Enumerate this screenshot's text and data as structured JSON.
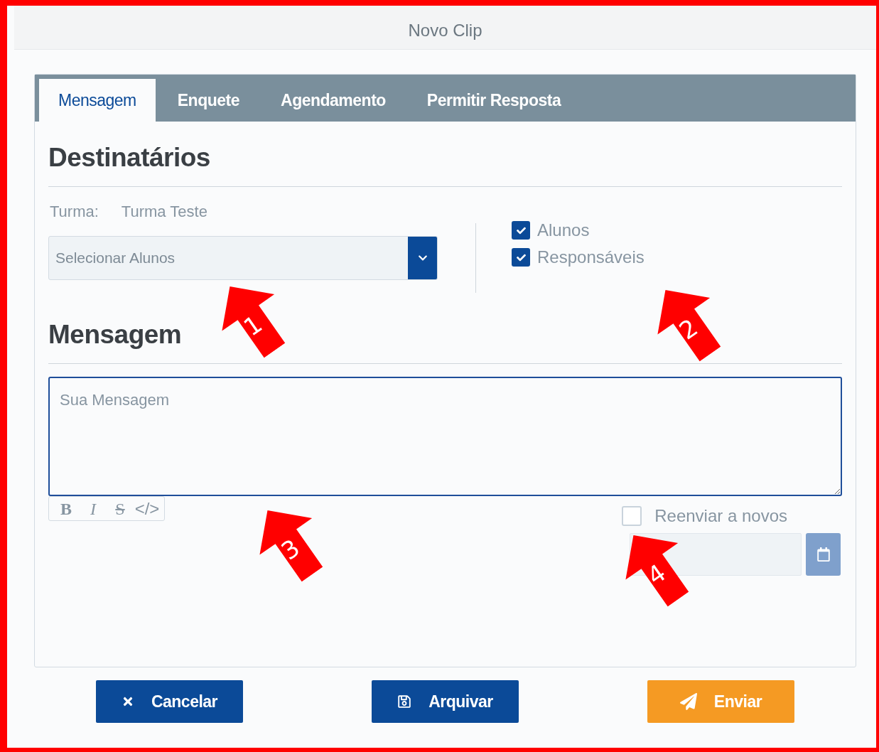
{
  "dialog": {
    "title": "Novo Clip"
  },
  "tabs": [
    {
      "label": "Mensagem",
      "selected": true
    },
    {
      "label": "Enquete",
      "selected": false
    },
    {
      "label": "Agendamento",
      "selected": false
    },
    {
      "label": "Permitir Resposta",
      "selected": false
    }
  ],
  "recipients": {
    "heading": "Destinatários",
    "class_label": "Turma:",
    "class_value": "Turma Teste",
    "select_placeholder": "Selecionar Alunos",
    "options": [
      {
        "label": "Alunos",
        "checked": true
      },
      {
        "label": "Responsáveis",
        "checked": true
      }
    ]
  },
  "message": {
    "heading": "Mensagem",
    "placeholder": "Sua Mensagem",
    "format_buttons": [
      {
        "kind": "bold",
        "label": "B"
      },
      {
        "kind": "italic",
        "label": "I"
      },
      {
        "kind": "strike",
        "label": "S"
      },
      {
        "kind": "code",
        "label": "</>"
      }
    ],
    "resend": {
      "label": "Reenviar a novos",
      "checked": false
    }
  },
  "buttons": [
    {
      "kind": "cancel",
      "label": "Cancelar"
    },
    {
      "kind": "archive",
      "label": "Arquivar"
    },
    {
      "kind": "send",
      "label": "Enviar"
    }
  ],
  "annotations": [
    {
      "label": "1"
    },
    {
      "label": "2"
    },
    {
      "label": "3"
    },
    {
      "label": "4"
    }
  ]
}
